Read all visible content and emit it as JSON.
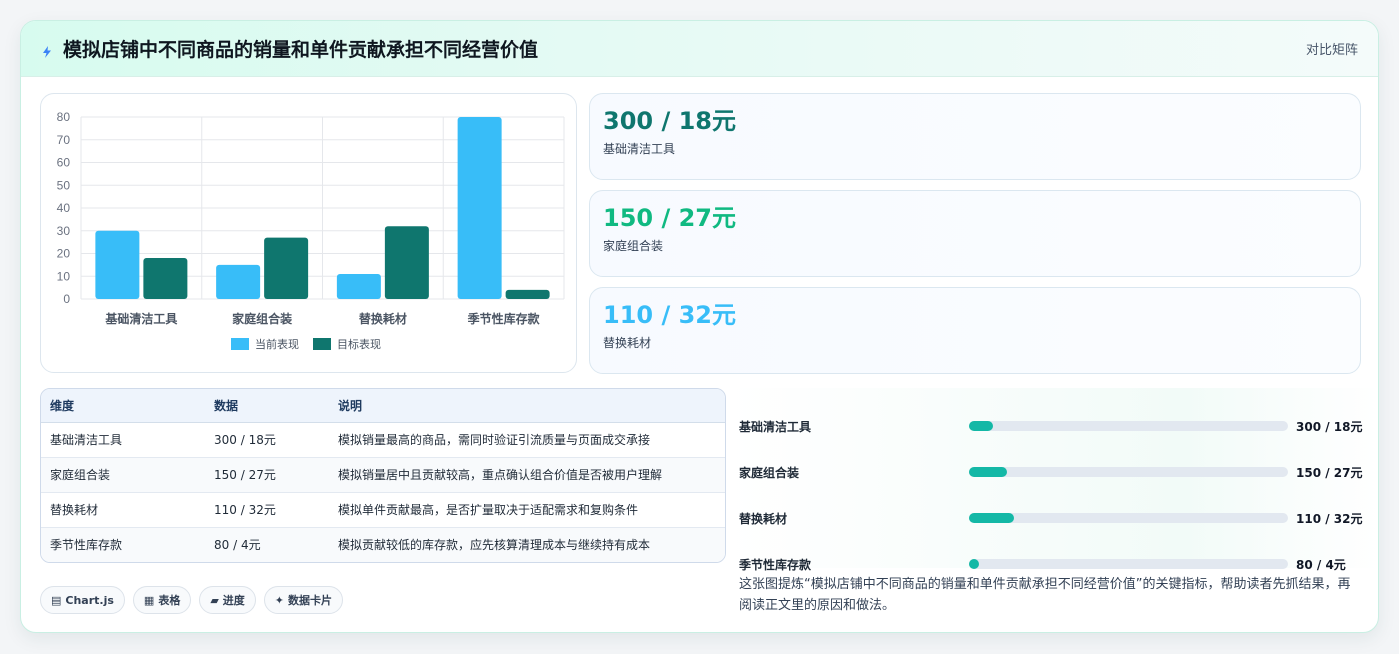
{
  "header": {
    "title": "模拟店铺中不同商品的销量和单件贡献承担不同经营价值",
    "tag": "对比矩阵"
  },
  "chart_data": {
    "type": "bar",
    "categories": [
      "基础清洁工具",
      "家庭组合装",
      "替换耗材",
      "季节性库存款"
    ],
    "series": [
      {
        "name": "当前表现",
        "values": [
          30,
          15,
          11,
          80
        ],
        "color": "#38bdf8"
      },
      {
        "name": "目标表现",
        "values": [
          18,
          27,
          32,
          4
        ],
        "color": "#0f766e"
      }
    ],
    "ylim": [
      0,
      80
    ],
    "yticks": [
      0,
      10,
      20,
      30,
      40,
      50,
      60,
      70,
      80
    ],
    "legend_position": "bottom",
    "grid": true
  },
  "stats": [
    {
      "value": "300 / 18元",
      "label": "基础清洁工具",
      "color": "#0f766e"
    },
    {
      "value": "150 / 27元",
      "label": "家庭组合装",
      "color": "#10b981"
    },
    {
      "value": "110 / 32元",
      "label": "替换耗材",
      "color": "#38bdf8"
    }
  ],
  "table": {
    "headers": [
      "维度",
      "数据",
      "说明"
    ],
    "rows": [
      [
        "基础清洁工具",
        "300 / 18元",
        "模拟销量最高的商品，需同时验证引流质量与页面成交承接"
      ],
      [
        "家庭组合装",
        "150 / 27元",
        "模拟销量居中且贡献较高，重点确认组合价值是否被用户理解"
      ],
      [
        "替换耗材",
        "110 / 32元",
        "模拟单件贡献最高，是否扩量取决于适配需求和复购条件"
      ],
      [
        "季节性库存款",
        "80 / 4元",
        "模拟贡献较低的库存款，应先核算清理成本与继续持有成本"
      ]
    ]
  },
  "chips": [
    {
      "icon": "chart-icon",
      "glyph": "▤",
      "label": "Chart.js"
    },
    {
      "icon": "table-icon",
      "glyph": "▦",
      "label": "表格"
    },
    {
      "icon": "progress-icon",
      "glyph": "▰",
      "label": "进度"
    },
    {
      "icon": "sparkle-icon",
      "glyph": "✦",
      "label": "数据卡片"
    }
  ],
  "progress": [
    {
      "label": "基础清洁工具",
      "value": "300 / 18元",
      "fraction": 0.075
    },
    {
      "label": "家庭组合装",
      "value": "150 / 27元",
      "fraction": 0.118
    },
    {
      "label": "替换耗材",
      "value": "110 / 32元",
      "fraction": 0.14
    },
    {
      "label": "季节性库存款",
      "value": "80 / 4元",
      "fraction": 0.03
    }
  ],
  "summary": "这张图提炼“模拟店铺中不同商品的销量和单件贡献承担不同经营价值”的关键指标，帮助读者先抓结果，再阅读正文里的原因和做法。"
}
